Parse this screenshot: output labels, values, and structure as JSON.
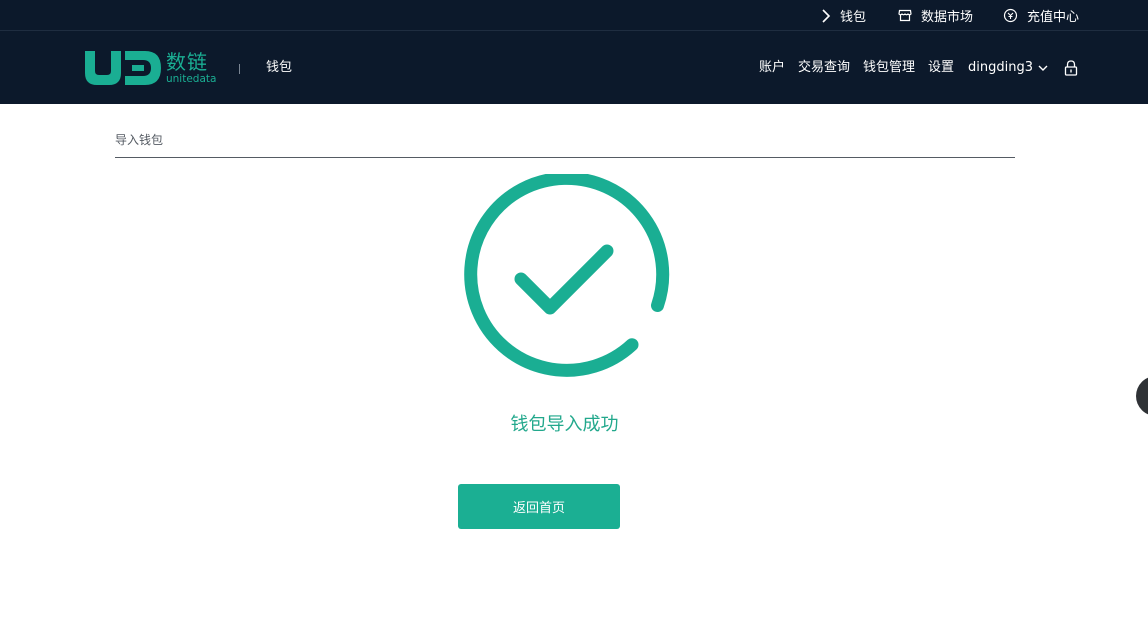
{
  "topbar": {
    "items": [
      {
        "label": "钱包",
        "icon": "chevron-right-icon"
      },
      {
        "label": "数据市场",
        "icon": "store-icon"
      },
      {
        "label": "充值中心",
        "icon": "recharge-icon"
      }
    ]
  },
  "header": {
    "logo": {
      "mark": "UD",
      "name_cn": "数链",
      "name_en": "unitedata"
    },
    "current_page": "钱包",
    "nav": [
      {
        "label": "账户"
      },
      {
        "label": "交易查询"
      },
      {
        "label": "钱包管理"
      },
      {
        "label": "设置"
      }
    ],
    "user": {
      "name": "dingding3",
      "icon": "chevron-down-icon"
    },
    "lock_icon": "lock-icon"
  },
  "content": {
    "section_title": "导入钱包",
    "status_icon": "success-check-icon",
    "success_message": "钱包导入成功",
    "home_button_label": "返回首页"
  },
  "colors": {
    "header_bg": "#0c192b",
    "accent": "#1aae93",
    "text_muted": "#555b63"
  }
}
